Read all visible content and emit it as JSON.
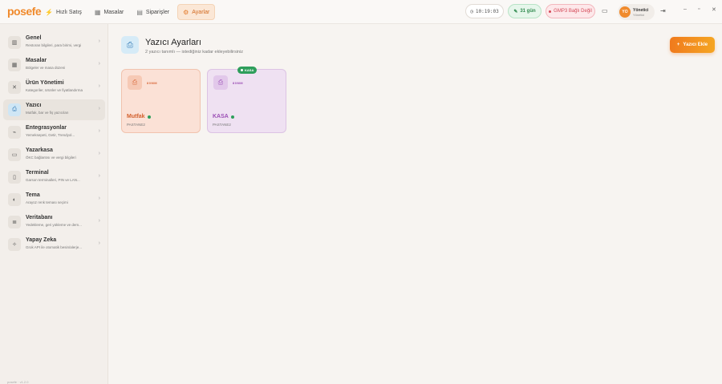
{
  "app": {
    "logo": "posefe"
  },
  "nav": [
    {
      "label": "Hızlı Satış",
      "icon": "bolt-icon"
    },
    {
      "label": "Masalar",
      "icon": "grid-icon"
    },
    {
      "label": "Siparişler",
      "icon": "receipt-icon"
    },
    {
      "label": "Ayarlar",
      "icon": "gear-icon",
      "active": true
    }
  ],
  "status": {
    "clock": "10:19:03",
    "days": "31 gün",
    "gmp": "GMP3 Bağlı Değil"
  },
  "user": {
    "initials": "YO",
    "name": "Yönetici",
    "role": "Yönetici"
  },
  "sidebar": {
    "items": [
      {
        "title": "Genel",
        "desc": "Restoran bilgileri, para birimi, vergi"
      },
      {
        "title": "Masalar",
        "desc": "Bölgeler ve masa düzeni"
      },
      {
        "title": "Ürün Yönetimi",
        "desc": "Kategoriler, ürünler ve fiyatlandırma"
      },
      {
        "title": "Yazıcı",
        "desc": "Mutfak, bar ve fiş yazıcıları",
        "active": true
      },
      {
        "title": "Entegrasyonlar",
        "desc": "Yemeksepeti, Getir, Trendyol..."
      },
      {
        "title": "Yazarkasa",
        "desc": "ÖKC bağlantısı ve vergi bilgileri"
      },
      {
        "title": "Terminal",
        "desc": "Garson terminalleri, PIN ve LAN..."
      },
      {
        "title": "Tema",
        "desc": "Arayüz renk teması seçimi"
      },
      {
        "title": "Veritabanı",
        "desc": "Yedekleme, geri yükleme ve dem..."
      },
      {
        "title": "Yapay Zeka",
        "desc": "Grok API ile otomatik besin/alerje..."
      }
    ],
    "version": "posefe · v1.2.0"
  },
  "page": {
    "title": "Yazıcı Ayarları",
    "subtitle": "2 yazıcı tanımlı — istediğiniz kadar ekleyebilirsiniz",
    "add_button": "Yazıcı Ekle"
  },
  "printers": [
    {
      "name": "Mutfak",
      "paper": "80MM",
      "connection": "PASTANE2",
      "badge": ""
    },
    {
      "name": "KASA",
      "paper": "80MM",
      "connection": "PASTANE2",
      "badge": "KASA"
    }
  ]
}
